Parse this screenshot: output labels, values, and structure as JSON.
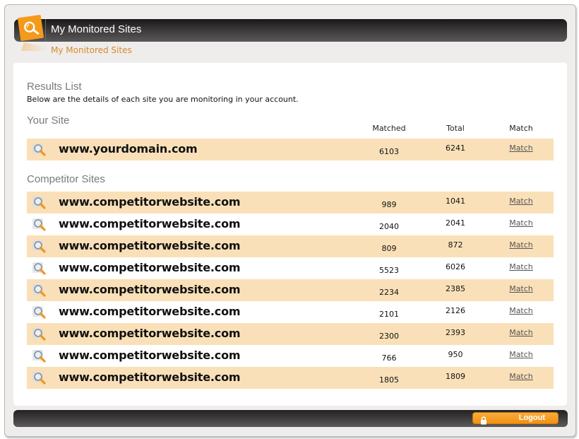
{
  "header": {
    "title": "My Monitored Sites",
    "breadcrumb": "My Monitored Sites",
    "logo_icon": "magnifier-icon",
    "accent_color": "#f49a1a"
  },
  "results": {
    "title": "Results List",
    "description": "Below are the details of each site you are monitoring in your account."
  },
  "columns": {
    "matched": "Matched",
    "total": "Total",
    "match": "Match"
  },
  "your_site": {
    "section_title": "Your Site",
    "rows": [
      {
        "site": "www.yourdomain.com",
        "matched": "6103",
        "total": "6241",
        "link": "Match"
      }
    ]
  },
  "competitors": {
    "section_title": "Competitor Sites",
    "rows": [
      {
        "site": "www.competitorwebsite.com",
        "matched": "989",
        "total": "1041",
        "link": "Match"
      },
      {
        "site": "www.competitorwebsite.com",
        "matched": "2040",
        "total": "2041",
        "link": "Match"
      },
      {
        "site": "www.competitorwebsite.com",
        "matched": "809",
        "total": "872",
        "link": "Match"
      },
      {
        "site": "www.competitorwebsite.com",
        "matched": "5523",
        "total": "6026",
        "link": "Match"
      },
      {
        "site": "www.competitorwebsite.com",
        "matched": "2234",
        "total": "2385",
        "link": "Match"
      },
      {
        "site": "www.competitorwebsite.com",
        "matched": "2101",
        "total": "2126",
        "link": "Match"
      },
      {
        "site": "www.competitorwebsite.com",
        "matched": "2300",
        "total": "2393",
        "link": "Match"
      },
      {
        "site": "www.competitorwebsite.com",
        "matched": "766",
        "total": "950",
        "link": "Match"
      },
      {
        "site": "www.competitorwebsite.com",
        "matched": "1805",
        "total": "1809",
        "link": "Match"
      }
    ]
  },
  "footer": {
    "logout_label": "Logout",
    "logout_icon": "lock-icon"
  },
  "colors": {
    "row_highlight": "#fae0b8",
    "breadcrumb": "#d68a2a",
    "button": "#f29211"
  }
}
